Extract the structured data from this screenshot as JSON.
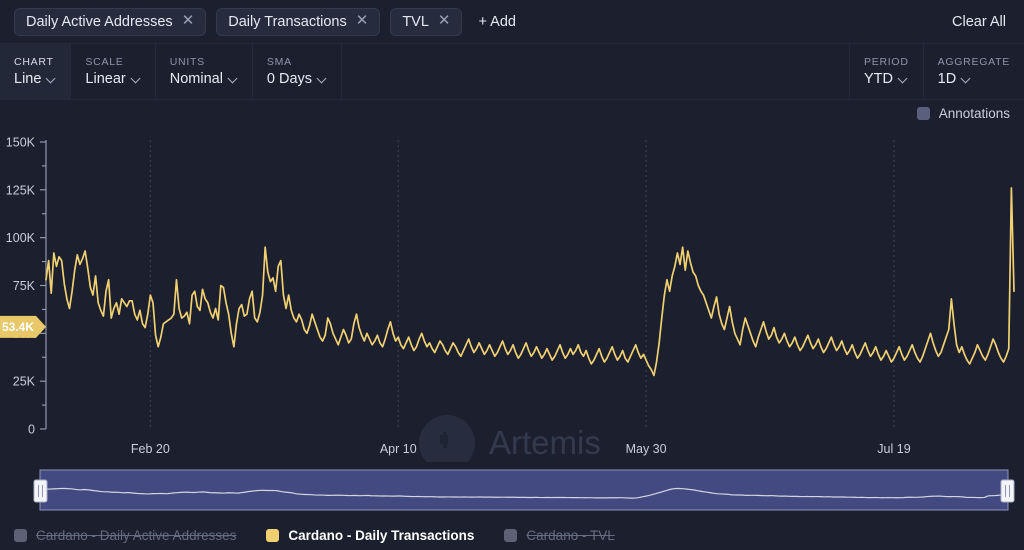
{
  "tabs": {
    "items": [
      {
        "label": "Daily Active Addresses",
        "close_icon": "close-icon"
      },
      {
        "label": "Daily Transactions",
        "close_icon": "close-icon"
      },
      {
        "label": "TVL",
        "close_icon": "close-icon"
      }
    ],
    "add_label": "+ Add",
    "clear_all_label": "Clear All"
  },
  "controls": [
    {
      "label": "CHART",
      "value": "Line"
    },
    {
      "label": "SCALE",
      "value": "Linear"
    },
    {
      "label": "UNITS",
      "value": "Nominal"
    },
    {
      "label": "SMA",
      "value": "0 Days"
    }
  ],
  "controls_right": [
    {
      "label": "PERIOD",
      "value": "YTD"
    },
    {
      "label": "AGGREGATE",
      "value": "1D"
    }
  ],
  "annotations": {
    "label": "Annotations",
    "checked": true,
    "color": "#5a5f7e"
  },
  "watermark": {
    "text": "Artemis",
    "logo_icon": "artemis-logo-icon"
  },
  "value_badge": {
    "text": "53.4K",
    "value": 53400,
    "color": "#e8c868"
  },
  "legend": [
    {
      "label": "Cardano - Daily Active Addresses",
      "color": "#5c6176",
      "active": false
    },
    {
      "label": "Cardano - Daily Transactions",
      "color": "#f0d071",
      "active": true
    },
    {
      "label": "Cardano - TVL",
      "color": "#5c6176",
      "active": false
    }
  ],
  "chart_data": {
    "type": "line",
    "title": "Cardano - Daily Transactions",
    "xlabel": "",
    "ylabel": "",
    "ylim": [
      0,
      150000
    ],
    "yticks": [
      0,
      25000,
      50000,
      75000,
      100000,
      125000,
      150000
    ],
    "ytick_labels": [
      "0",
      "25K",
      "50K",
      "75K",
      "100K",
      "125K",
      "150K"
    ],
    "xticks": [
      40,
      135,
      230,
      325
    ],
    "xtick_labels": [
      "Feb 20",
      "Apr 10",
      "May 30",
      "Jul 19"
    ],
    "grid": "vertical-dotted",
    "legend_position": "bottom",
    "line_color": "#f0d071",
    "series": [
      {
        "name": "Cardano - Daily Transactions",
        "color": "#f0d071",
        "values": [
          78000,
          88000,
          71000,
          92000,
          85000,
          90000,
          88000,
          76000,
          68000,
          63000,
          72000,
          83000,
          91000,
          86000,
          89000,
          93000,
          84000,
          74000,
          70000,
          80000,
          66000,
          62000,
          59000,
          72000,
          78000,
          58000,
          63000,
          66000,
          60000,
          68000,
          66000,
          64000,
          67000,
          67000,
          60000,
          57000,
          62000,
          55000,
          53000,
          60000,
          70000,
          66000,
          49000,
          43000,
          48000,
          55000,
          56000,
          57000,
          58000,
          60000,
          78000,
          63000,
          58000,
          59000,
          61000,
          55000,
          70000,
          72000,
          64000,
          62000,
          73000,
          68000,
          66000,
          61000,
          58000,
          63000,
          57000,
          75000,
          74000,
          66000,
          60000,
          50000,
          43000,
          55000,
          63000,
          65000,
          59000,
          60000,
          68000,
          72000,
          58000,
          56000,
          61000,
          70000,
          95000,
          82000,
          77000,
          79000,
          72000,
          85000,
          88000,
          70000,
          63000,
          70000,
          62000,
          58000,
          56000,
          60000,
          57000,
          52000,
          50000,
          54000,
          60000,
          56000,
          52000,
          48000,
          46000,
          49000,
          58000,
          55000,
          50000,
          47000,
          44000,
          48000,
          52000,
          49000,
          45000,
          47000,
          55000,
          60000,
          53000,
          49000,
          46000,
          50000,
          47000,
          44000,
          46000,
          49000,
          45000,
          43000,
          47000,
          52000,
          56000,
          50000,
          46000,
          48000,
          44000,
          42000,
          45000,
          48000,
          44000,
          41000,
          43000,
          47000,
          50000,
          46000,
          43000,
          45000,
          42000,
          40000,
          43000,
          46000,
          44000,
          41000,
          39000,
          42000,
          45000,
          43000,
          40000,
          38000,
          41000,
          44000,
          47000,
          43000,
          40000,
          42000,
          45000,
          42000,
          39000,
          41000,
          44000,
          41000,
          38000,
          40000,
          43000,
          46000,
          42000,
          39000,
          41000,
          44000,
          40000,
          37000,
          39000,
          42000,
          45000,
          41000,
          38000,
          40000,
          43000,
          40000,
          37000,
          39000,
          42000,
          39000,
          36000,
          38000,
          41000,
          44000,
          40000,
          37000,
          39000,
          42000,
          39000,
          41000,
          44000,
          40000,
          38000,
          41000,
          37000,
          34000,
          36000,
          39000,
          42000,
          38000,
          35000,
          37000,
          40000,
          43000,
          39000,
          36000,
          38000,
          41000,
          37000,
          35000,
          38000,
          41000,
          44000,
          40000,
          37000,
          39000,
          36000,
          33000,
          31000,
          28000,
          35000,
          45000,
          58000,
          70000,
          78000,
          72000,
          80000,
          85000,
          92000,
          86000,
          95000,
          83000,
          93000,
          87000,
          82000,
          80000,
          75000,
          72000,
          70000,
          66000,
          62000,
          58000,
          64000,
          69000,
          60000,
          55000,
          52000,
          58000,
          64000,
          56000,
          50000,
          47000,
          44000,
          52000,
          58000,
          54000,
          50000,
          46000,
          43000,
          48000,
          52000,
          56000,
          51000,
          47000,
          49000,
          53000,
          48000,
          45000,
          47000,
          50000,
          46000,
          43000,
          45000,
          48000,
          44000,
          41000,
          43000,
          46000,
          49000,
          45000,
          42000,
          44000,
          47000,
          43000,
          40000,
          42000,
          45000,
          48000,
          44000,
          41000,
          43000,
          46000,
          42000,
          39000,
          41000,
          44000,
          40000,
          37000,
          39000,
          42000,
          45000,
          41000,
          38000,
          40000,
          43000,
          39000,
          36000,
          38000,
          41000,
          38000,
          35000,
          37000,
          40000,
          43000,
          39000,
          36000,
          38000,
          41000,
          44000,
          40000,
          37000,
          35000,
          38000,
          42000,
          46000,
          50000,
          45000,
          41000,
          38000,
          40000,
          44000,
          48000,
          52000,
          68000,
          55000,
          44000,
          40000,
          43000,
          39000,
          36000,
          34000,
          37000,
          40000,
          44000,
          41000,
          38000,
          36000,
          39000,
          43000,
          47000,
          44000,
          40000,
          37000,
          35000,
          38000,
          42000,
          126000,
          72000
        ]
      }
    ]
  },
  "brush": {
    "selected": true,
    "left_handle_icon": "brush-handle-left",
    "right_handle_icon": "brush-handle-right",
    "selection_color": "#4a5291",
    "line_color": "#d3d6e2"
  }
}
